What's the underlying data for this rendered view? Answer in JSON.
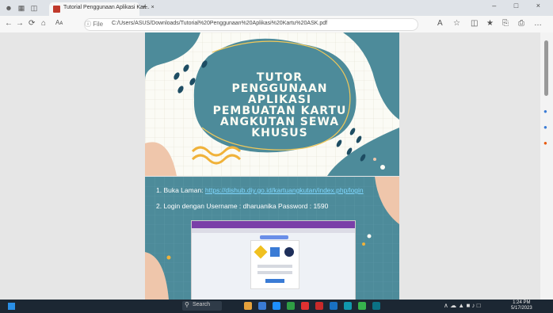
{
  "browser": {
    "tab_title": "Tutorial Penggunaan Aplikasi Kar... ×",
    "tab_close": "×",
    "new_tab": "+",
    "window_controls": "– □ ×",
    "url_prefix": "ⓘ File",
    "url": "C:/Users/ASUS/Downloads/Tutorial%20Penggunaan%20Aplikasi%20Kartu%20ASK.pdf",
    "nav": {
      "back": "←",
      "forward": "→",
      "reload": "⟳",
      "home": "⌂",
      "read": "Aᴀ"
    },
    "toolbar_icons": [
      "A",
      "☆",
      "◫",
      "★",
      "⎘",
      "⎙",
      "…"
    ]
  },
  "slide1": {
    "title_lines": [
      "TUTOR",
      "PENGGUNAAN",
      "APLIKASI",
      "PEMBUATAN KARTU",
      "ANGKUTAN SEWA",
      "KHUSUS"
    ],
    "colors": {
      "teal": "#4d8b9a",
      "dark": "#1e4d63",
      "peach": "#efc6ab",
      "yellow": "#f0b23a"
    }
  },
  "slide2": {
    "step1_prefix": "1. Buka Laman:",
    "step1_link": "https://dishub.diy.go.id/kartuangkutan/index.php/login",
    "step2": "2. Login dengan Username : dharuanika Password : 1590"
  },
  "taskbar": {
    "search_label": "Search",
    "tray": "∧ ☁ ▲ ■ ♪ □",
    "time": "1:24 PM",
    "date": "5/17/2023",
    "app_colors": [
      "#e6a23c",
      "#3a7bd5",
      "#1e90ff",
      "#2f9e44",
      "#e03131",
      "#c92a2a",
      "#1971c2",
      "#1098ad",
      "#37b24d",
      "#0b7285"
    ]
  }
}
